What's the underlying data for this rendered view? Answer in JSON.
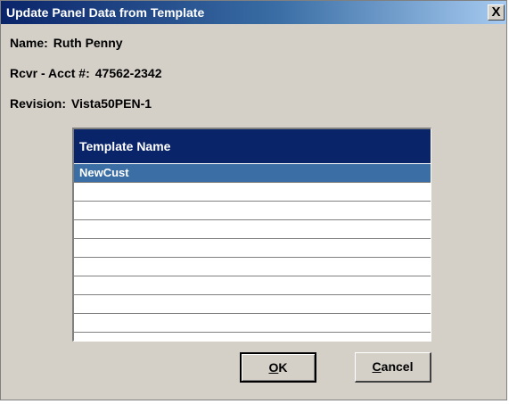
{
  "window": {
    "title": "Update Panel Data from Template",
    "close_glyph": "X"
  },
  "info": {
    "name_label": "Name:",
    "name_value": "Ruth Penny",
    "acct_label": "Rcvr - Acct #:",
    "acct_value": "47562-2342",
    "revision_label": "Revision:",
    "revision_value": "Vista50PEN-1"
  },
  "template_list": {
    "header": "Template Name",
    "rows": [
      "NewCust",
      "",
      "",
      "",
      "",
      "",
      "",
      "",
      "",
      ""
    ],
    "selected_index": 0
  },
  "buttons": {
    "ok_mnemonic": "O",
    "ok_rest": "K",
    "cancel_mnemonic": "C",
    "cancel_rest": "ancel"
  },
  "colors": {
    "title_bar": "#0a246a",
    "selection": "#3a6ea5",
    "dialog_face": "#d4d0c8"
  }
}
